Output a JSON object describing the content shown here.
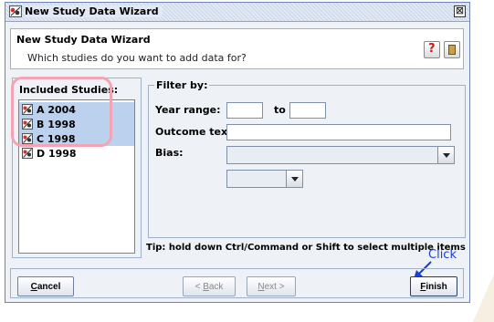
{
  "window": {
    "title": "New Study Data Wizard",
    "close_glyph": "⊠"
  },
  "header": {
    "title": "New Study Data Wizard",
    "subtitle": "Which studies do you want to add data for?",
    "help_glyph": "?"
  },
  "included": {
    "label": "Included Studies:",
    "studies": [
      {
        "name": "A 2004",
        "selected": true
      },
      {
        "name": "B 1998",
        "selected": true
      },
      {
        "name": "C 1998",
        "selected": true
      },
      {
        "name": "D 1998",
        "selected": false
      }
    ]
  },
  "filter": {
    "legend": "Filter by:",
    "year_range_label": "Year range:",
    "to_label": "to",
    "year_from_value": "",
    "year_to_value": "",
    "outcome_label": "Outcome text:",
    "outcome_value": "",
    "bias_label": "Bias:",
    "bias_value": "",
    "bias_level_value": ""
  },
  "tip": "Tip: hold down Ctrl/Command or Shift to select multiple items",
  "annotation": {
    "text": "Click",
    "color": "#1c3fd6"
  },
  "buttons": {
    "cancel": {
      "prefix": "",
      "mnemonic": "C",
      "rest": "ancel"
    },
    "back": {
      "prefix": "< ",
      "mnemonic": "B",
      "rest": "ack"
    },
    "next": {
      "prefix": "",
      "mnemonic": "N",
      "rest": "ext >"
    },
    "finish": {
      "prefix": "",
      "mnemonic": "F",
      "rest": "inish"
    }
  },
  "colors": {
    "selection": "#bcd1ee",
    "highlight": "#f2a4b4",
    "window_bg": "#eef2f7"
  }
}
